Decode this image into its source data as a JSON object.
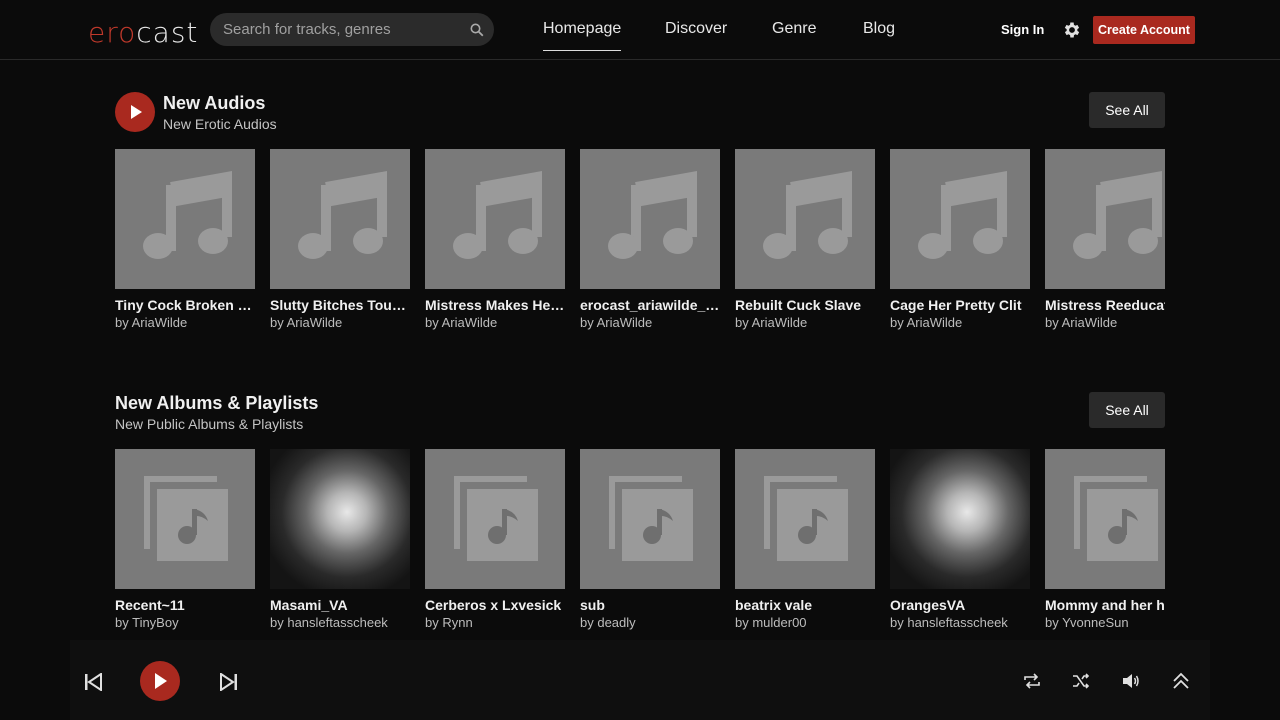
{
  "header": {
    "logo_part1": "ero",
    "logo_part2": "cast",
    "search_placeholder": "Search for tracks, genres",
    "nav": [
      "Homepage",
      "Discover",
      "Genre",
      "Blog"
    ],
    "sign_in": "Sign In",
    "create_account": "Create Account"
  },
  "sections": {
    "audios": {
      "title": "New Audios",
      "subtitle": "New Erotic Audios",
      "see_all": "See All",
      "items": [
        {
          "title": "Tiny Cock Broken Mind Bimbo",
          "by": "by AriaWilde"
        },
        {
          "title": "Slutty Bitches Touch Yourself",
          "by": "by AriaWilde"
        },
        {
          "title": "Mistress Makes Her Sissy",
          "by": "by AriaWilde"
        },
        {
          "title": "erocast_ariawilde_audio",
          "by": "by AriaWilde"
        },
        {
          "title": "Rebuilt Cuck Slave",
          "by": "by AriaWilde"
        },
        {
          "title": "Cage Her Pretty Clit",
          "by": "by AriaWilde"
        },
        {
          "title": "Mistress Reeducates",
          "by": "by AriaWilde"
        }
      ]
    },
    "albums": {
      "title": "New Albums & Playlists",
      "subtitle": "New Public Albums & Playlists",
      "see_all": "See All",
      "items": [
        {
          "title": "Recent~11",
          "by": "by TinyBoy",
          "art": "playlist"
        },
        {
          "title": "Masami_VA",
          "by": "by hansleftasscheek",
          "art": "flower"
        },
        {
          "title": "Cerberos x Lxvesick",
          "by": "by Rynn",
          "art": "playlist"
        },
        {
          "title": "sub",
          "by": "by deadly",
          "art": "playlist"
        },
        {
          "title": "beatrix vale",
          "by": "by mulder00",
          "art": "playlist"
        },
        {
          "title": "OrangesVA",
          "by": "by hansleftasscheek",
          "art": "flower"
        },
        {
          "title": "Mommy and her h",
          "by": "by YvonneSun",
          "art": "playlist"
        }
      ]
    }
  },
  "colors": {
    "accent": "#a9291f",
    "background": "#0b0b0b"
  },
  "player_icons": [
    "previous-icon",
    "play-icon",
    "next-icon",
    "repeat-icon",
    "shuffle-icon",
    "volume-icon",
    "expand-icon"
  ]
}
